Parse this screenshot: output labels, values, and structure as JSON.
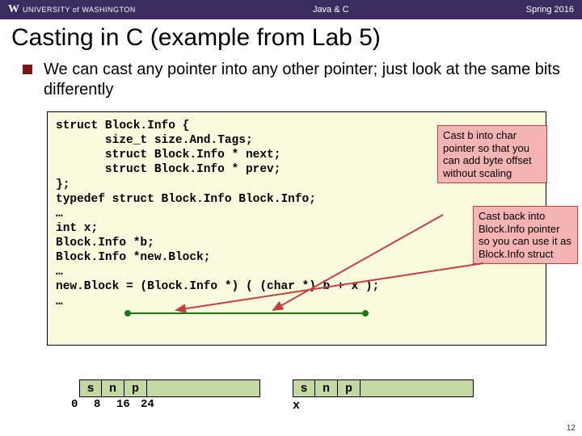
{
  "header": {
    "university": "UNIVERSITY of WASHINGTON",
    "center": "Java & C",
    "right": "Spring 2016"
  },
  "title": "Casting in C (example from Lab 5)",
  "bullet": "We can cast any pointer into any other pointer; just look at the same bits differently",
  "code": "struct Block.Info {\n       size_t size.And.Tags;\n       struct Block.Info * next;\n       struct Block.Info * prev;\n};\ntypedef struct Block.Info Block.Info;\n…\nint x;\nBlock.Info *b;\nBlock.Info *new.Block;\n…\nnew.Block = (Block.Info *) ( (char *) b + x );\n…",
  "callout1": "Cast b into char pointer so that you can add byte offset without scaling",
  "callout2": "Cast back into Block.Info pointer so you can use it as Block.Info struct",
  "mem": {
    "s": "s",
    "n": "n",
    "p": "p"
  },
  "offsets": {
    "o0": "0",
    "o8": "8",
    "o16": "16",
    "o24": "24"
  },
  "xlabel": "x",
  "pagenum": "12"
}
